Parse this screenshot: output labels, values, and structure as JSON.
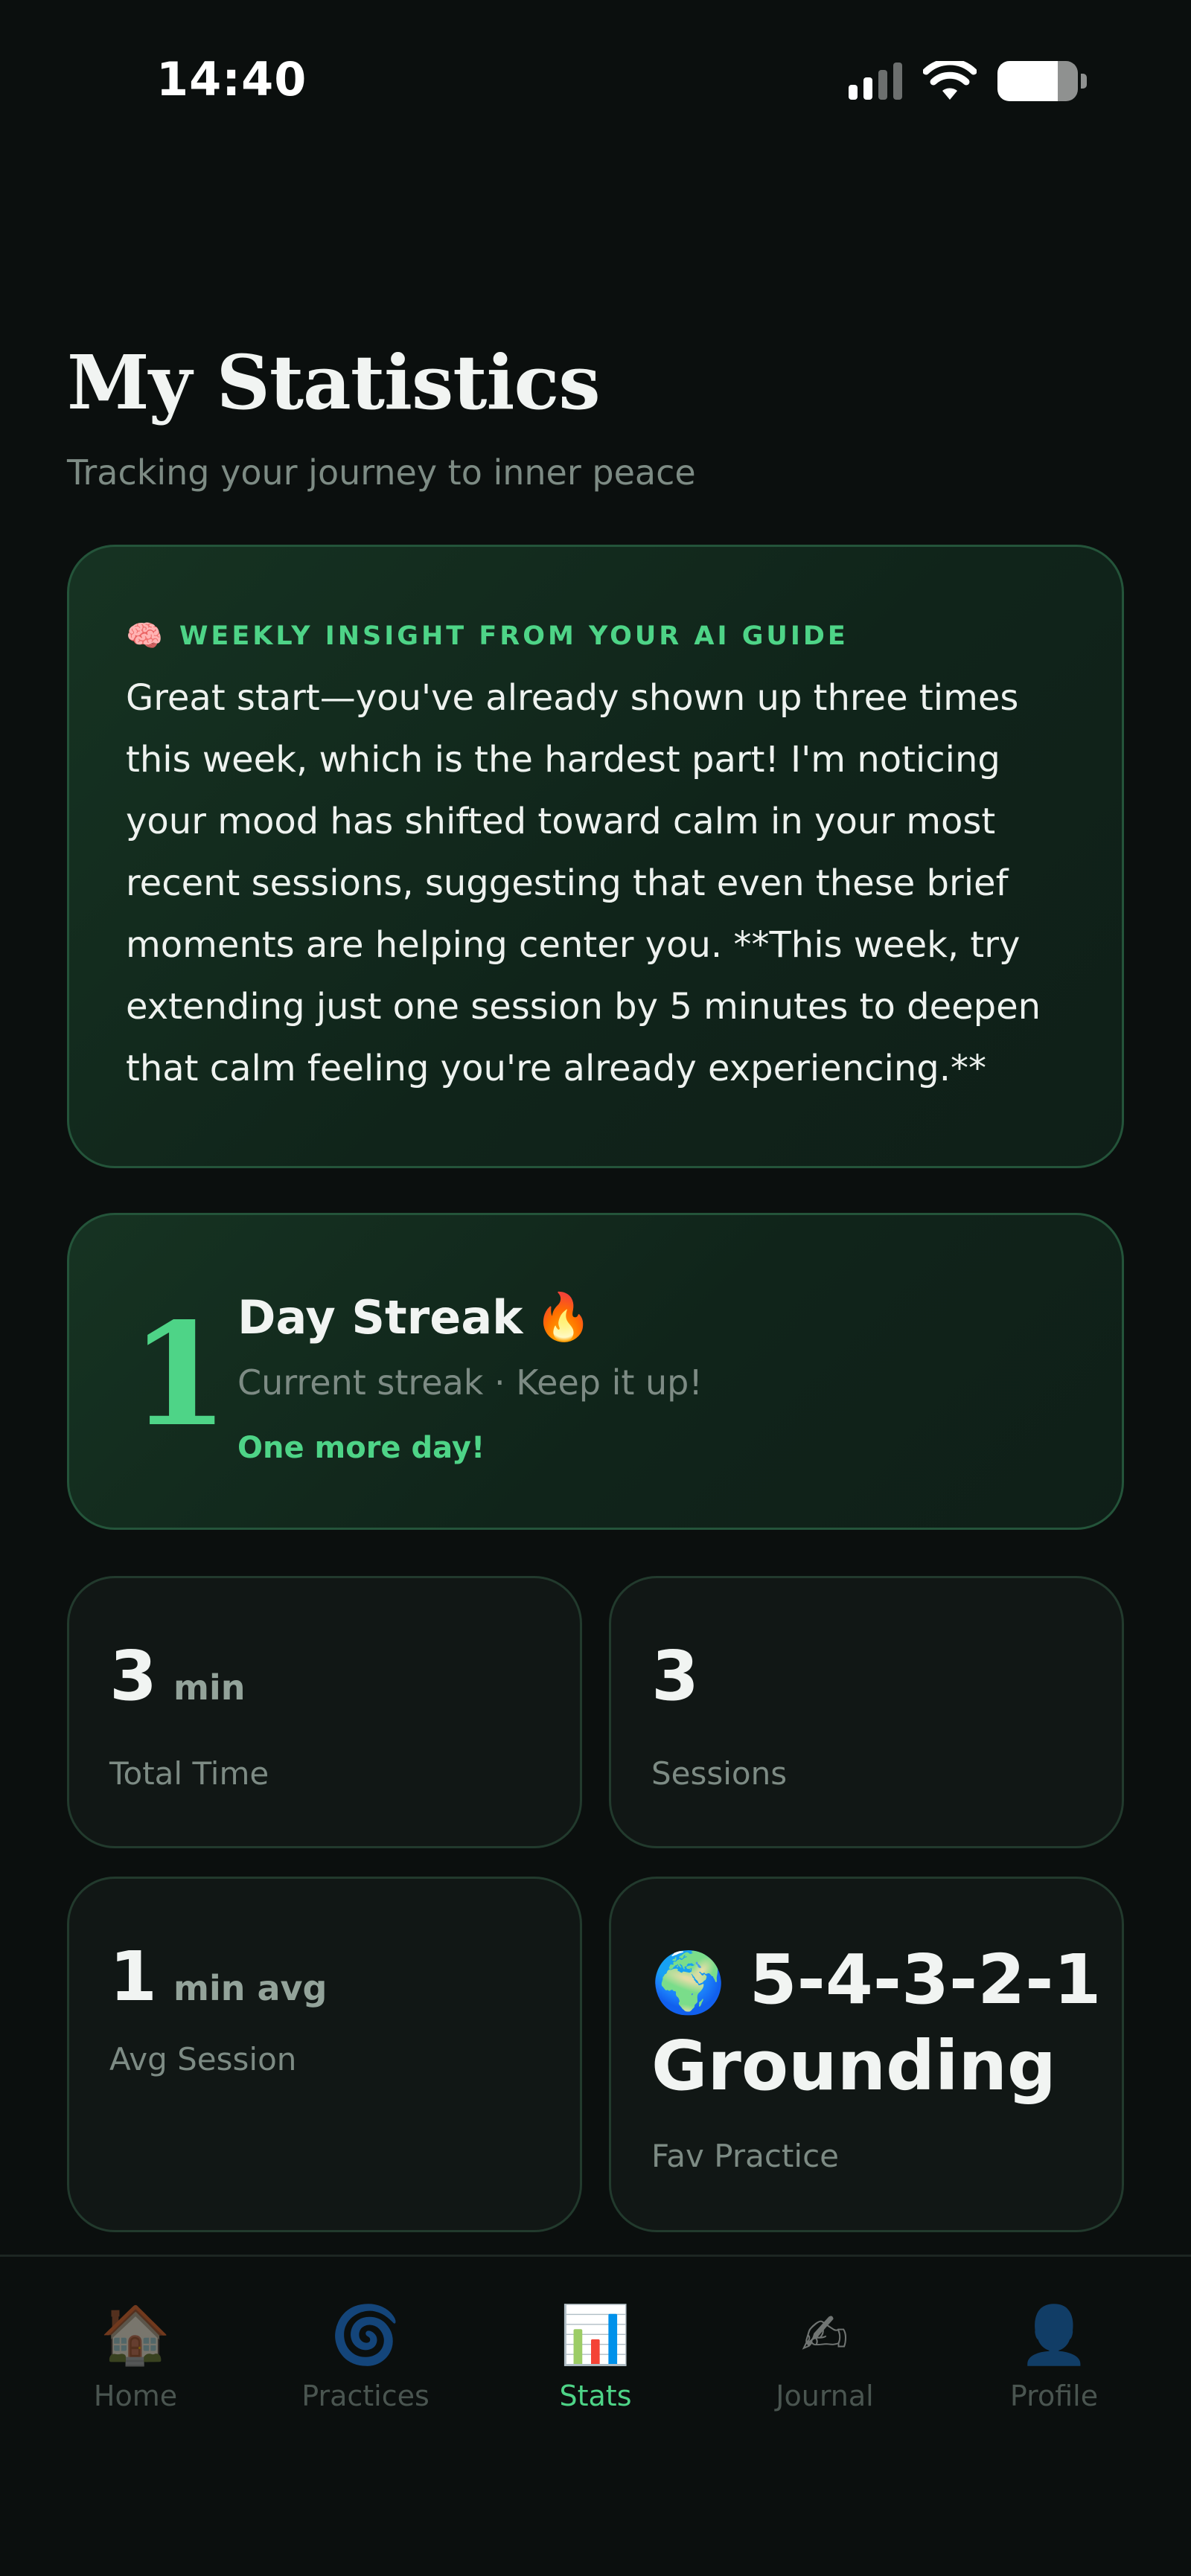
{
  "status_bar": {
    "time": "14:40",
    "battery_level": 0.75
  },
  "header": {
    "title": "My Statistics",
    "subtitle": "Tracking your journey to inner peace"
  },
  "insight": {
    "icon": "brain-icon",
    "label": "WEEKLY INSIGHT FROM YOUR AI GUIDE",
    "text": "Great start—you've already shown up three times this week, which is the hardest part! I'm noticing your mood has shifted toward calm in your most recent sessions, suggesting that even these brief moments are helping center you. **This week, try extending just one session by 5 minutes to deepen that calm feeling you're already experiencing.**"
  },
  "streak": {
    "number": "1",
    "title": "Day Streak",
    "icon": "fire-icon",
    "subtitle": "Current streak · Keep it up!",
    "cheer": "One more day!"
  },
  "stats": {
    "total_time": {
      "value": "3",
      "unit": "min",
      "label": "Total Time"
    },
    "sessions": {
      "value": "3",
      "label": "Sessions"
    },
    "avg_session": {
      "value": "1",
      "unit": "min avg",
      "label": "Avg Session"
    },
    "fav_practice": {
      "icon": "globe-icon",
      "value": "5-4-3-2-1 Grounding",
      "label": "Fav Practice"
    }
  },
  "nav": {
    "items": [
      {
        "label": "Home",
        "icon": "house-icon"
      },
      {
        "label": "Practices",
        "icon": "spiral-icon"
      },
      {
        "label": "Stats",
        "icon": "bar-chart-icon",
        "active": true
      },
      {
        "label": "Journal",
        "icon": "writing-hand-icon"
      },
      {
        "label": "Profile",
        "icon": "person-silhouette-icon"
      }
    ]
  },
  "colors": {
    "background": "#0b0f0e",
    "accent": "#4ed487",
    "muted_text": "#7d8b84"
  }
}
